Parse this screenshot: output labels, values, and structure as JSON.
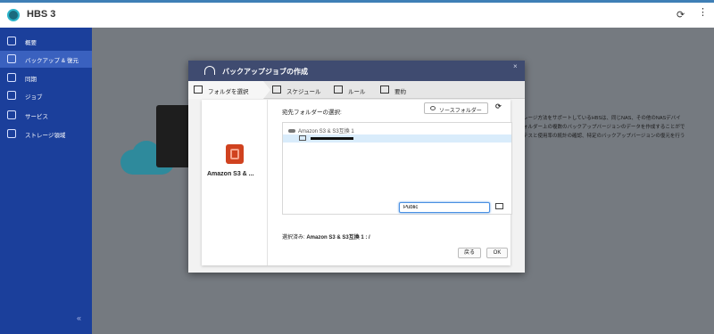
{
  "app": {
    "title": "HBS 3"
  },
  "sidebar": {
    "items": [
      {
        "label": "概要",
        "icon": "dashboard-icon"
      },
      {
        "label": "バックアップ & 復元",
        "icon": "backup-icon"
      },
      {
        "label": "同期",
        "icon": "sync-icon"
      },
      {
        "label": "ジョブ",
        "icon": "job-icon"
      },
      {
        "label": "サービス",
        "icon": "service-icon"
      },
      {
        "label": "ストレージ領域",
        "icon": "storage-icon"
      }
    ],
    "collapse_glyph": "«"
  },
  "background": {
    "text": "レージ方法をサポートしているHBSは、同じNAS、その他のNASデバイ\nォルダー上の複数のバックアップバージョンのデータを作成することがで\nテスと使用率の統計の確認、特定のバックアップバージョンの復元を行う"
  },
  "dialog": {
    "title": "バックアップジョブの作成",
    "close": "×",
    "steps": [
      {
        "label": "フォルダを選択",
        "icon": "folder-select-icon"
      },
      {
        "label": "スケジュール",
        "icon": "calendar-icon"
      },
      {
        "label": "ルール",
        "icon": "rules-icon"
      },
      {
        "label": "要約",
        "icon": "summary-icon"
      }
    ],
    "service_name": "Amazon S3 & ...",
    "dest_label": "宛先フォルダーの選択:",
    "source_button": "ソースフォルダー",
    "tree_root": "Amazon S3 & S3互換 1",
    "path_value": "Public",
    "selected_prefix": "選択済み: ",
    "selected_value": "Amazon S3 & S3互換 1 : /",
    "back_label": "戻る",
    "ok_label": "OK"
  },
  "colors": {
    "sidebar": "#1b3f9b",
    "sidebar_active": "#3a61bf",
    "dialog_header": "#3f4b70",
    "selection": "#d9ecfb",
    "accent": "#4a90e2"
  }
}
